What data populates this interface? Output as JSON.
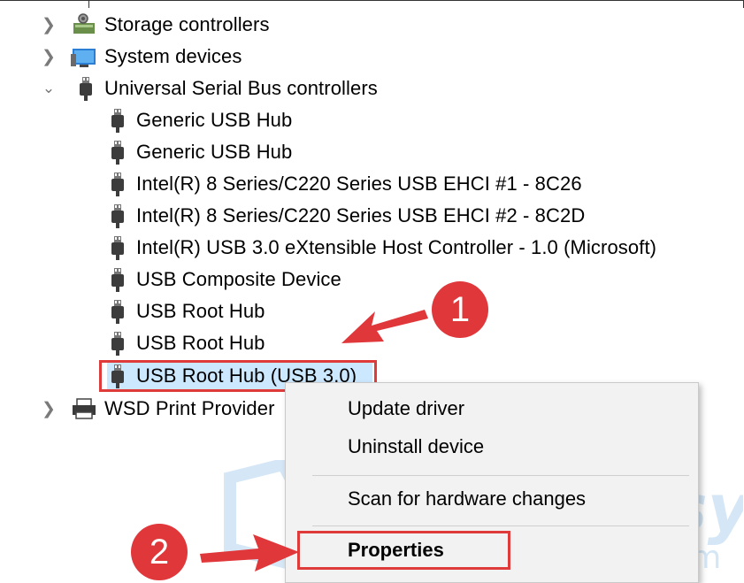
{
  "tree": {
    "collapsed_top": [
      {
        "label": "Storage controllers",
        "icon": "storage-controller-icon"
      },
      {
        "label": "System devices",
        "icon": "system-devices-icon"
      }
    ],
    "usb_category": {
      "label": "Universal Serial Bus controllers",
      "icon": "usb-plug-icon",
      "expanded": true
    },
    "usb_children": [
      "Generic USB Hub",
      "Generic USB Hub",
      "Intel(R) 8 Series/C220 Series USB EHCI #1 - 8C26",
      "Intel(R) 8 Series/C220 Series USB EHCI #2 - 8C2D",
      "Intel(R) USB 3.0 eXtensible Host Controller - 1.0 (Microsoft)",
      "USB Composite Device",
      "USB Root Hub",
      "USB Root Hub",
      "USB Root Hub (USB 3.0)"
    ],
    "selected_child_index": 8,
    "collapsed_bottom": [
      {
        "label": "WSD Print Provider",
        "icon": "printer-icon"
      }
    ]
  },
  "context_menu": {
    "items": [
      "Update driver",
      "Uninstall device",
      "Scan for hardware changes",
      "Properties"
    ],
    "bold_item_index": 3
  },
  "annotations": {
    "step1": "1",
    "step2": "2",
    "color": "#e0373a"
  },
  "watermark": {
    "brand": "driver easy",
    "url": "www.DriverEasy.com"
  }
}
